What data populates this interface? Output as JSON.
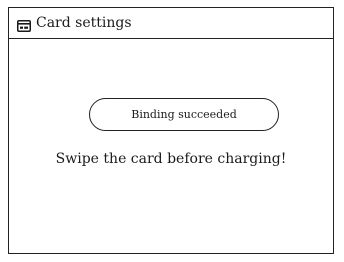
{
  "header": {
    "title": "Card settings",
    "icon": "card-icon"
  },
  "main": {
    "status_label": "Binding succeeded",
    "message": "Swipe the card before charging!"
  }
}
